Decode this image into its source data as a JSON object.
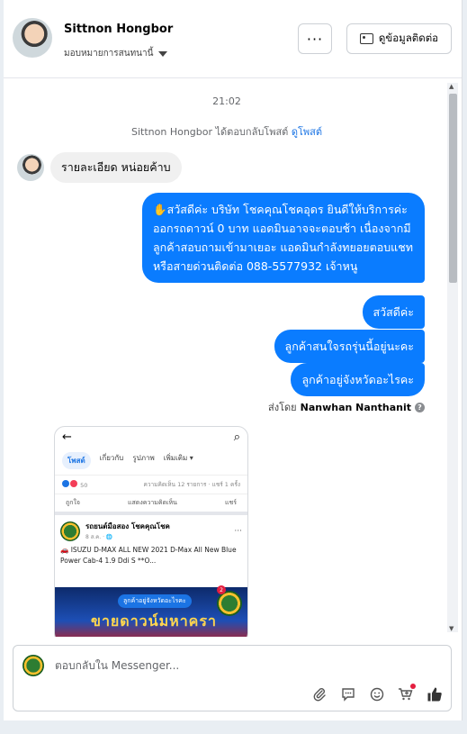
{
  "header": {
    "name": "Sittnon Hongbor",
    "assign_label": "มอบหมายการสนทนานี้",
    "more_label": "···",
    "contact_button": "ดูข้อมูลติดต่อ"
  },
  "chat": {
    "timestamp": "21:02",
    "system_prefix": "Sittnon Hongbor ได้ตอบกลับโพสต์",
    "system_link": "ดูโพสต์",
    "incoming": "รายละเอียด หน่อยค้าบ",
    "outgoing_long": "✋สวัสดีค่ะ บริษัท โชคคุณโชคอุดร ยินดีให้บริการค่ะ ออกรถดาวน์ 0 บาท แอดมินอาจจะตอบช้า เนื่องจากมีลูกค้าสอบถามเข้ามาเยอะ แอดมินกำลังทยอยตอบแชท หรือสายด่วนติดต่อ 088-5577932 เจ้าหนู",
    "outgoing_1": "สวัสดีค่ะ",
    "outgoing_2": "ลูกค้าสนใจรถรุ่นนี้อยู่นะคะ",
    "outgoing_3": "ลูกค้าอยู่จังหวัดอะไรคะ",
    "sent_by_prefix": "ส่งโดย",
    "sent_by_name": "Nanwhan Nanthanit"
  },
  "shot": {
    "back": "←",
    "search": "⌕",
    "tabs": [
      "โพสต์",
      "เกี่ยวกับ",
      "รูปภาพ",
      "เพิ่มเติม ▾"
    ],
    "reaction_count": "50",
    "comments_shares": "ความคิดเห็น 12 รายการ · แชร์ 1 ครั้ง",
    "actions": [
      "ถูกใจ",
      "แสดงความคิดเห็น",
      "แชร์"
    ],
    "page_name": "รถยนต์มือสอง โชคคุณโชค",
    "post_time": "8 ส.ค. · 🌐",
    "post_text": "🚗 ISUZU D-MAX ALL NEW 2021 D-Max All New Blue Power Cab-4 1.9 Ddi S **O...",
    "image_banner": "ลูกค้าอยู่จังหวัดอะไรคะ",
    "image_big_text": "ขายดาวน์มหาครา",
    "image_badge": "2"
  },
  "composer": {
    "placeholder": "ตอบกลับใน Messenger..."
  },
  "colors": {
    "accent": "#0a7cff",
    "link": "#1b74e4"
  },
  "icons": [
    "attach-icon",
    "gif-icon",
    "emoji-icon",
    "add-to-cart-icon",
    "like-icon"
  ]
}
